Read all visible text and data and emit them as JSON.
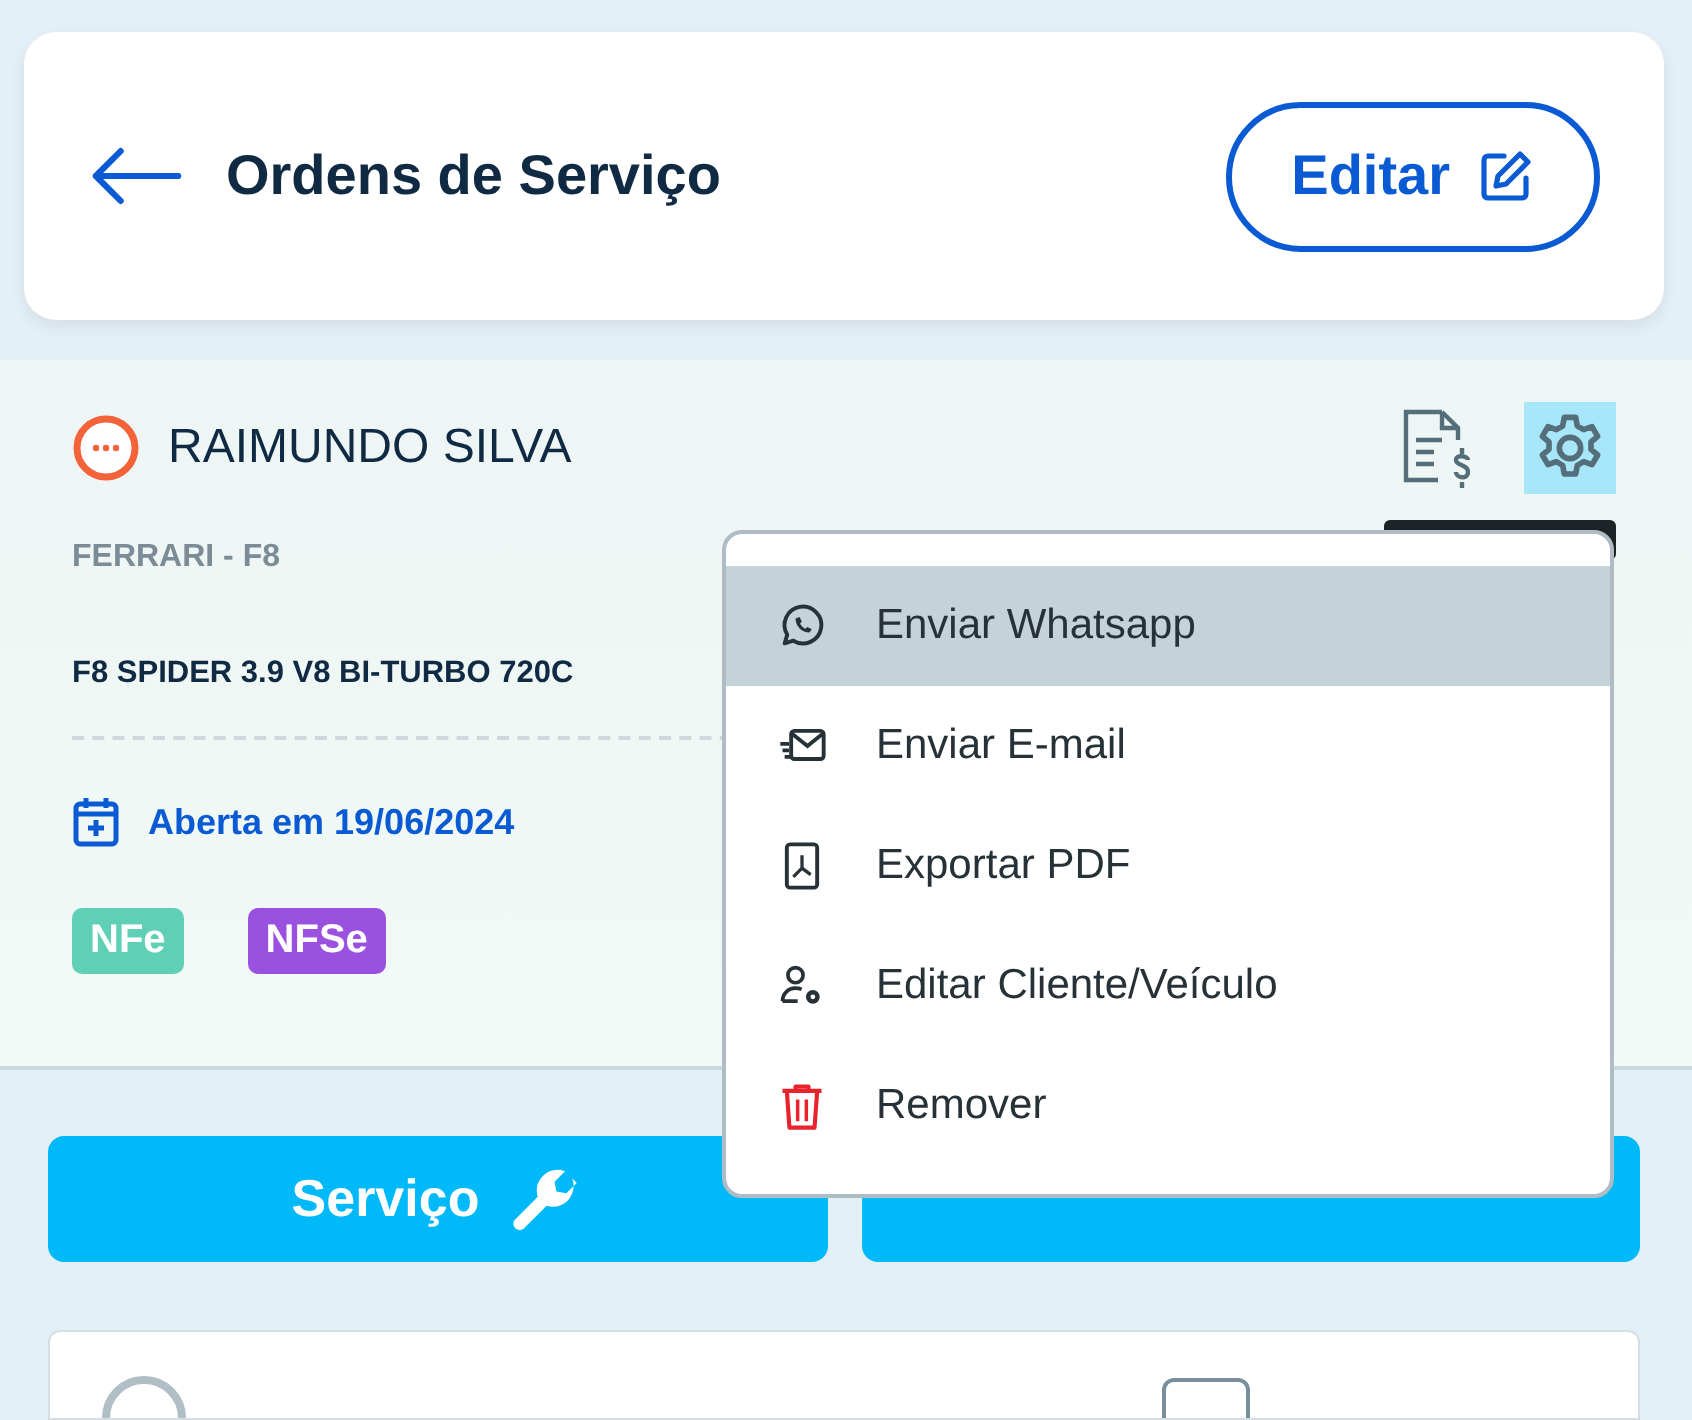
{
  "header": {
    "title": "Ordens de Serviço",
    "edit_button": "Editar"
  },
  "order": {
    "client": "RAIMUNDO SILVA",
    "vehicle": "FERRARI - F8",
    "version": "F8 SPIDER 3.9 V8 BI-TURBO 720C",
    "opened": "Aberta em 19/06/2024",
    "tags": [
      {
        "label": "NFe",
        "color": "#5fd0b5"
      },
      {
        "label": "NFSe",
        "color": "#9b51e0"
      }
    ]
  },
  "add_buttons": [
    {
      "label": "Serviço",
      "kind": "service"
    },
    {
      "kind": "product"
    }
  ],
  "items": [
    {
      "checked": false
    }
  ],
  "menu": {
    "items": [
      {
        "label": "Enviar Whatsapp",
        "kind": "whatsapp",
        "selected": true
      },
      {
        "label": "Enviar E-mail",
        "kind": "email",
        "selected": false
      },
      {
        "label": "Exportar PDF",
        "kind": "pdf",
        "selected": false
      },
      {
        "label": "Editar Cliente/Veículo",
        "kind": "user",
        "selected": false
      },
      {
        "label": "Remover",
        "kind": "trash",
        "selected": false
      }
    ]
  }
}
